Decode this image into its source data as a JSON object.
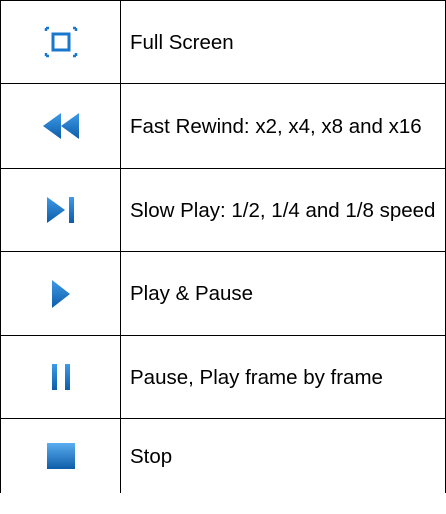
{
  "controls": [
    {
      "icon": "fullscreen-icon",
      "label": "Full Screen"
    },
    {
      "icon": "fast-rewind-icon",
      "label": "Fast Rewind: x2, x4, x8 and x16"
    },
    {
      "icon": "slow-play-icon",
      "label": "Slow Play: 1/2, 1/4 and 1/8 speed"
    },
    {
      "icon": "play-icon",
      "label": "Play & Pause"
    },
    {
      "icon": "pause-icon",
      "label": "Pause, Play frame by frame"
    },
    {
      "icon": "stop-icon",
      "label": "Stop"
    }
  ],
  "colors": {
    "icon_blue": "#1a78cc",
    "icon_blue_dark": "#0d5ca8",
    "icon_blue_light": "#3d9be8",
    "border": "#000000"
  }
}
